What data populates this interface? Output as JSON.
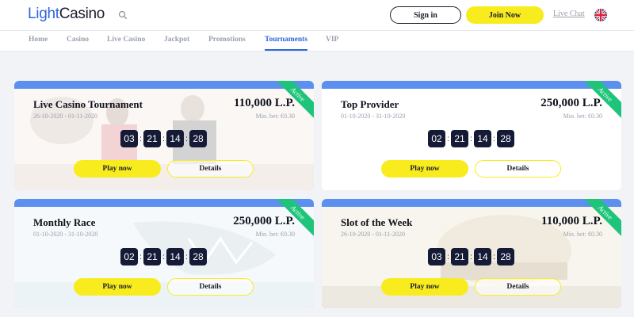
{
  "header": {
    "logo_part1": "Light",
    "logo_part2": "Casino",
    "signin_label": "Sign in",
    "join_label": "Join Now",
    "livechat_label": "Live Chat",
    "language_flag": "uk-flag-icon"
  },
  "nav": {
    "items": [
      {
        "label": "Home"
      },
      {
        "label": "Casino"
      },
      {
        "label": "Live Casino"
      },
      {
        "label": "Jackpot"
      },
      {
        "label": "Promotions"
      },
      {
        "label": "Tournaments",
        "active": true
      },
      {
        "label": "VIP"
      }
    ]
  },
  "colors": {
    "brand_blue": "#2f66d8",
    "accent_yellow": "#f8ec1e",
    "active_green": "#1ec47a",
    "timer_navy": "#151a36"
  },
  "tournaments": [
    {
      "title": "Live Casino Tournament",
      "prize": "110,000 L.P.",
      "dates": "26-10-2020 - 01-11-2020",
      "min_bet": "Min. bet: €0.30",
      "status": "Active",
      "timer": [
        "03",
        "21",
        "14",
        "28"
      ],
      "play_label": "Play now",
      "details_label": "Details"
    },
    {
      "title": "Top Provider",
      "prize": "250,000 L.P.",
      "dates": "01-10-2020 - 31-10-2020",
      "min_bet": "Min. bet: €0.30",
      "status": "Active",
      "timer": [
        "02",
        "21",
        "14",
        "28"
      ],
      "play_label": "Play now",
      "details_label": "Details"
    },
    {
      "title": "Monthly Race",
      "prize": "250,000 L.P.",
      "dates": "01-10-2020 - 31-10-2020",
      "min_bet": "Min. bet: €0.30",
      "status": "Active",
      "timer": [
        "02",
        "21",
        "14",
        "28"
      ],
      "play_label": "Play now",
      "details_label": "Details"
    },
    {
      "title": "Slot of the Week",
      "prize": "110,000 L.P.",
      "dates": "26-10-2020 - 01-11-2020",
      "min_bet": "Min. bet: €0.30",
      "status": "Active",
      "timer": [
        "03",
        "21",
        "14",
        "28"
      ],
      "play_label": "Play now",
      "details_label": "Details"
    }
  ]
}
